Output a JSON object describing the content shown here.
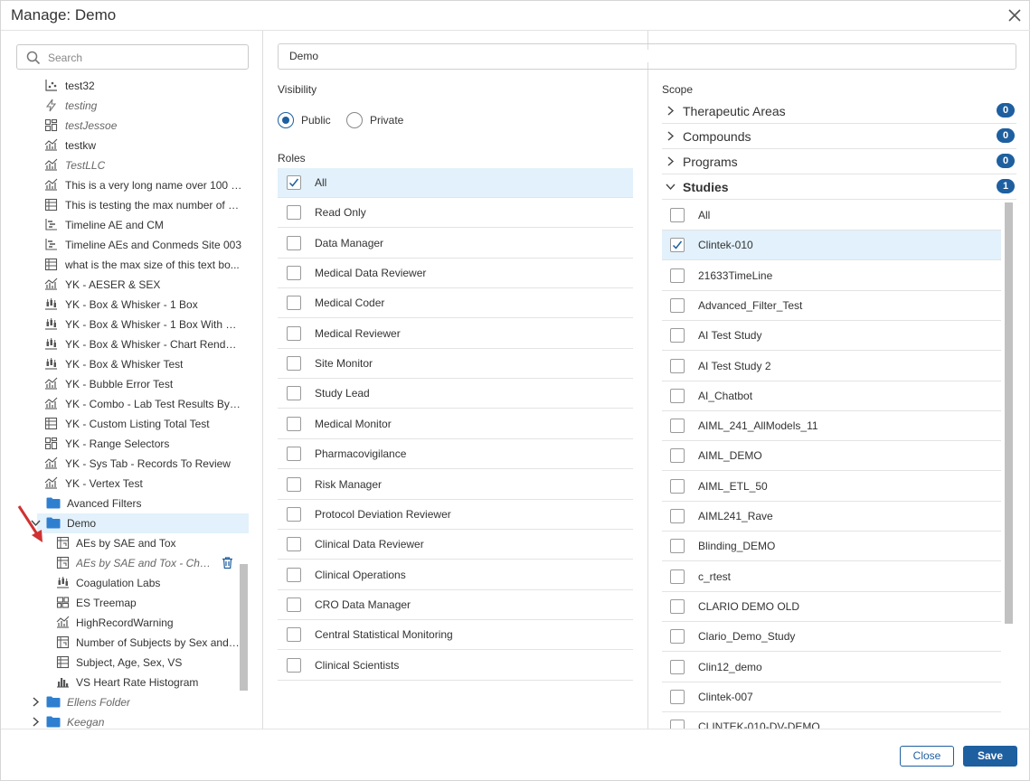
{
  "dialog": {
    "title": "Manage: Demo"
  },
  "search": {
    "placeholder": "Search"
  },
  "tree": {
    "items": [
      {
        "label": "test32",
        "icon": "scatter-chart-icon",
        "italic": false
      },
      {
        "label": "testing",
        "icon": "bolt-icon",
        "italic": true
      },
      {
        "label": "testJessoe",
        "icon": "dashboard-grid-icon",
        "italic": true
      },
      {
        "label": "testkw",
        "icon": "combo-chart-icon",
        "italic": false
      },
      {
        "label": "TestLLC",
        "icon": "combo-chart-icon",
        "italic": true
      },
      {
        "label": "This is a very long name over 100 c...",
        "icon": "combo-chart-icon",
        "italic": false
      },
      {
        "label": "This is testing the max number of c...",
        "icon": "table-icon",
        "italic": false
      },
      {
        "label": "Timeline AE and CM",
        "icon": "timeline-icon",
        "italic": false
      },
      {
        "label": "Timeline AEs and Conmeds Site 003",
        "icon": "timeline-icon",
        "italic": false
      },
      {
        "label": "what is the max size of this text bo...",
        "icon": "table-icon",
        "italic": false
      },
      {
        "label": "YK - AESER & SEX",
        "icon": "combo-chart-icon",
        "italic": false
      },
      {
        "label": "YK - Box & Whisker - 1 Box",
        "icon": "box-whisker-icon",
        "italic": false
      },
      {
        "label": "YK - Box & Whisker - 1 Box With Di...",
        "icon": "box-whisker-icon",
        "italic": false
      },
      {
        "label": "YK - Box & Whisker - Chart Render T...",
        "icon": "box-whisker-icon",
        "italic": false
      },
      {
        "label": "YK - Box & Whisker Test",
        "icon": "box-whisker-icon",
        "italic": false
      },
      {
        "label": "YK - Bubble Error Test",
        "icon": "combo-chart-icon",
        "italic": false
      },
      {
        "label": "YK - Combo - Lab Test Results By T...",
        "icon": "combo-chart-icon",
        "italic": false
      },
      {
        "label": "YK - Custom Listing Total Test",
        "icon": "table-icon",
        "italic": false
      },
      {
        "label": "YK - Range Selectors",
        "icon": "dashboard-grid-icon",
        "italic": false
      },
      {
        "label": "YK - Sys Tab - Records To Review",
        "icon": "combo-chart-icon",
        "italic": false
      },
      {
        "label": "YK - Vertex Test",
        "icon": "combo-chart-icon",
        "italic": false
      }
    ],
    "folders": {
      "avanced": "Avanced Filters",
      "demo": "Demo",
      "ellens": "Ellens Folder",
      "keegan": "Keegan"
    },
    "demo_children": [
      {
        "label": "AEs by SAE and Tox",
        "icon": "pivot-table-icon",
        "italic": false
      },
      {
        "label": "AEs by SAE and Tox - Chart",
        "icon": "pivot-table-icon",
        "italic": true
      },
      {
        "label": "Coagulation Labs",
        "icon": "box-whisker-icon",
        "italic": false
      },
      {
        "label": "ES Treemap",
        "icon": "treemap-icon",
        "italic": false
      },
      {
        "label": "HighRecordWarning",
        "icon": "combo-chart-icon",
        "italic": false
      },
      {
        "label": "Number of Subjects by Sex and E...",
        "icon": "pivot-table-icon",
        "italic": false
      },
      {
        "label": "Subject, Age, Sex, VS",
        "icon": "table-icon",
        "italic": false
      },
      {
        "label": "VS Heart Rate Histogram",
        "icon": "histogram-icon",
        "italic": false
      }
    ]
  },
  "form": {
    "name_value": "Demo",
    "visibility_label": "Visibility",
    "public_label": "Public",
    "private_label": "Private",
    "roles_label": "Roles",
    "scope_label": "Scope"
  },
  "roles": [
    {
      "label": "All",
      "checked": true
    },
    {
      "label": "Read Only",
      "checked": false
    },
    {
      "label": "Data Manager",
      "checked": false
    },
    {
      "label": "Medical Data Reviewer",
      "checked": false
    },
    {
      "label": "Medical Coder",
      "checked": false
    },
    {
      "label": "Medical Reviewer",
      "checked": false
    },
    {
      "label": "Site Monitor",
      "checked": false
    },
    {
      "label": "Study Lead",
      "checked": false
    },
    {
      "label": "Medical Monitor",
      "checked": false
    },
    {
      "label": "Pharmacovigilance",
      "checked": false
    },
    {
      "label": "Risk Manager",
      "checked": false
    },
    {
      "label": "Protocol Deviation Reviewer",
      "checked": false
    },
    {
      "label": "Clinical Data Reviewer",
      "checked": false
    },
    {
      "label": "Clinical Operations",
      "checked": false
    },
    {
      "label": "CRO Data Manager",
      "checked": false
    },
    {
      "label": "Central Statistical Monitoring",
      "checked": false
    },
    {
      "label": "Clinical Scientists",
      "checked": false
    }
  ],
  "scope": [
    {
      "label": "Therapeutic Areas",
      "count": "0",
      "expanded": false
    },
    {
      "label": "Compounds",
      "count": "0",
      "expanded": false
    },
    {
      "label": "Programs",
      "count": "0",
      "expanded": false
    },
    {
      "label": "Studies",
      "count": "1",
      "expanded": true
    }
  ],
  "studies": [
    {
      "label": "All",
      "checked": false
    },
    {
      "label": "Clintek-010",
      "checked": true
    },
    {
      "label": "21633TimeLine",
      "checked": false
    },
    {
      "label": "Advanced_Filter_Test",
      "checked": false
    },
    {
      "label": "AI Test Study",
      "checked": false
    },
    {
      "label": "AI Test Study 2",
      "checked": false
    },
    {
      "label": "AI_Chatbot",
      "checked": false
    },
    {
      "label": "AIML_241_AllModels_11",
      "checked": false
    },
    {
      "label": "AIML_DEMO",
      "checked": false
    },
    {
      "label": "AIML_ETL_50",
      "checked": false
    },
    {
      "label": "AIML241_Rave",
      "checked": false
    },
    {
      "label": "Blinding_DEMO",
      "checked": false
    },
    {
      "label": "c_rtest",
      "checked": false
    },
    {
      "label": "CLARIO DEMO OLD",
      "checked": false
    },
    {
      "label": "Clario_Demo_Study",
      "checked": false
    },
    {
      "label": "Clin12_demo",
      "checked": false
    },
    {
      "label": "Clintek-007",
      "checked": false
    },
    {
      "label": "CLINTEK-010-DV-DEMO",
      "checked": false
    }
  ],
  "footer": {
    "close_label": "Close",
    "save_label": "Save"
  },
  "colors": {
    "accent": "#1e5fa0",
    "selection": "#e2f1fb",
    "folder": "#2f7fd0",
    "annotation_arrow": "#d03232"
  }
}
